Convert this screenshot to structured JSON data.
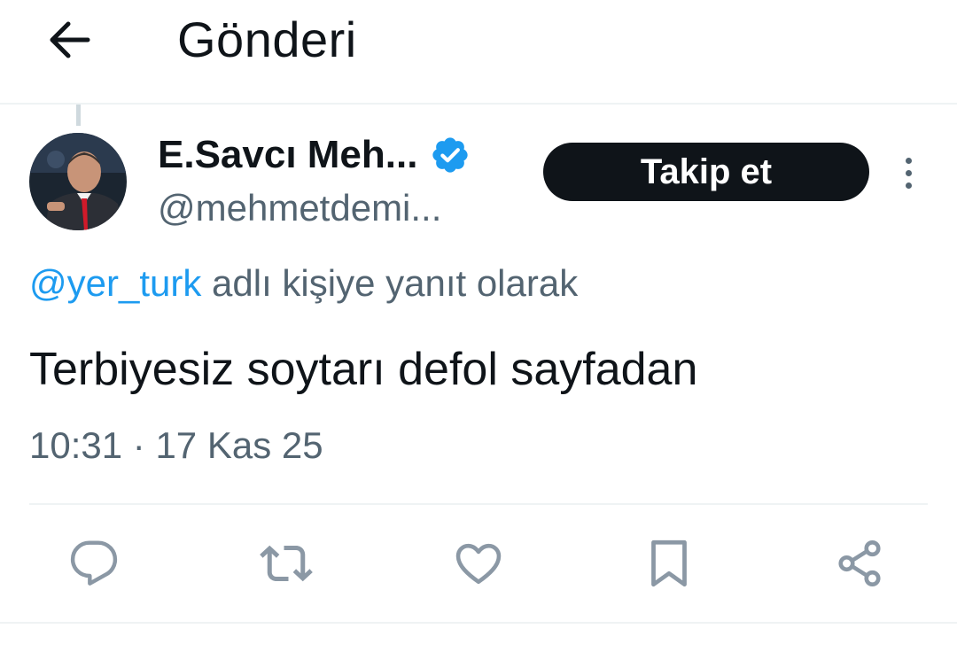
{
  "header": {
    "title": "Gönderi",
    "back_icon": "arrow-left-icon"
  },
  "author": {
    "display_name": "E.Savcı Meh...",
    "handle": "@mehmetdemi...",
    "verified_icon": "verified-badge-icon",
    "verified_color": "#1d9bf0"
  },
  "follow_button": {
    "label": "Takip et"
  },
  "more_icon": "more-vertical-icon",
  "reply_context": {
    "mention": "@yer_turk",
    "suffix": " adlı kişiye yanıt olarak"
  },
  "tweet": {
    "text": "Terbiyesiz soytarı defol sayfadan",
    "time": "10:31",
    "separator": " · ",
    "date": "17 Kas 25"
  },
  "actions": [
    {
      "name": "reply",
      "icon": "reply-icon"
    },
    {
      "name": "retweet",
      "icon": "retweet-icon"
    },
    {
      "name": "like",
      "icon": "heart-icon"
    },
    {
      "name": "bookmark",
      "icon": "bookmark-icon"
    },
    {
      "name": "share",
      "icon": "share-icon"
    }
  ],
  "colors": {
    "text_primary": "#0f1419",
    "text_secondary": "#536471",
    "accent": "#1d9bf0",
    "divider": "#eff3f4"
  }
}
